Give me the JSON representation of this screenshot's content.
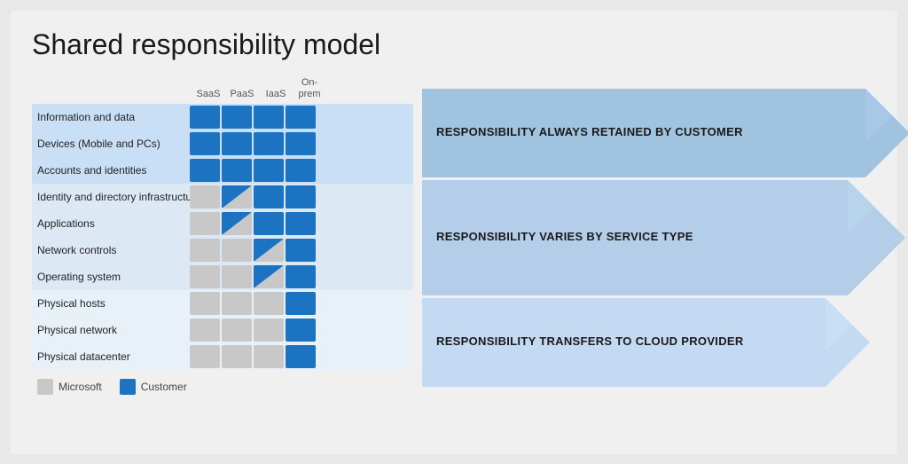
{
  "title": "Shared responsibility model",
  "columns": [
    "SaaS",
    "PaaS",
    "IaaS",
    "On-prem"
  ],
  "bands": [
    {
      "id": "customer",
      "arrowLabel": "RESPONSIBILITY ALWAYS RETAINED BY CUSTOMER",
      "rows": [
        {
          "label": "Information and data",
          "cells": [
            "blue",
            "blue",
            "blue",
            "blue"
          ]
        },
        {
          "label": "Devices (Mobile and PCs)",
          "cells": [
            "blue",
            "blue",
            "blue",
            "blue"
          ]
        },
        {
          "label": "Accounts and identities",
          "cells": [
            "blue",
            "blue",
            "blue",
            "blue"
          ]
        }
      ]
    },
    {
      "id": "varies",
      "arrowLabel": "RESPONSIBILITY VARIES BY SERVICE TYPE",
      "rows": [
        {
          "label": "Identity and directory infrastructure",
          "cells": [
            "gray",
            "half",
            "blue",
            "blue"
          ]
        },
        {
          "label": "Applications",
          "cells": [
            "gray",
            "half",
            "blue",
            "blue"
          ]
        },
        {
          "label": "Network controls",
          "cells": [
            "gray",
            "gray",
            "half",
            "blue"
          ]
        },
        {
          "label": "Operating system",
          "cells": [
            "gray",
            "gray",
            "half",
            "blue"
          ]
        }
      ]
    },
    {
      "id": "provider",
      "arrowLabel": "RESPONSIBILITY TRANSFERS TO CLOUD PROVIDER",
      "rows": [
        {
          "label": "Physical hosts",
          "cells": [
            "gray",
            "gray",
            "gray",
            "blue"
          ]
        },
        {
          "label": "Physical network",
          "cells": [
            "gray",
            "gray",
            "gray",
            "blue"
          ]
        },
        {
          "label": "Physical datacenter",
          "cells": [
            "gray",
            "gray",
            "gray",
            "blue"
          ]
        }
      ]
    }
  ],
  "legend": {
    "microsoft_label": "Microsoft",
    "customer_label": "Customer"
  }
}
